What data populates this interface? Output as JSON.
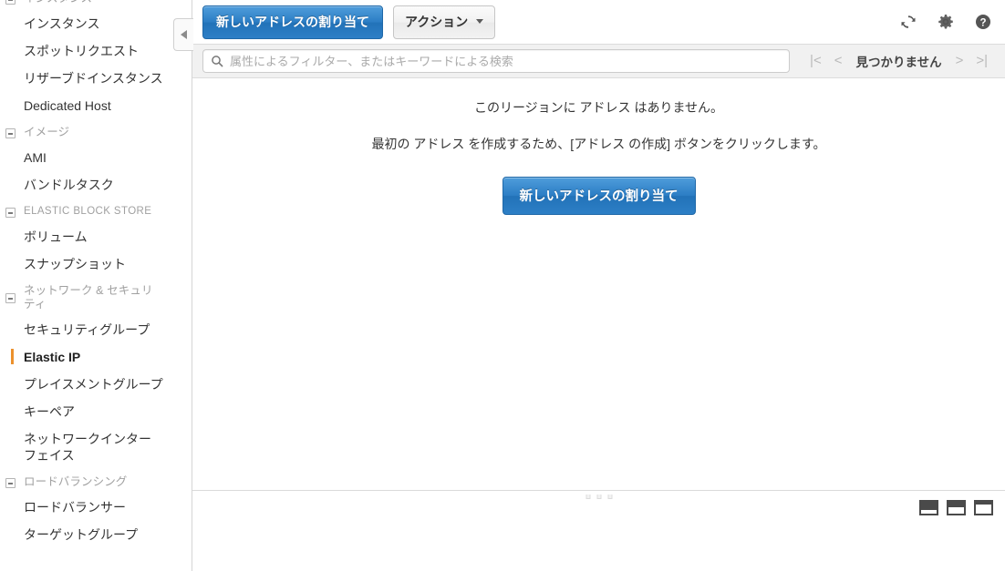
{
  "sidebar": {
    "groups": [
      {
        "id": "instances",
        "label": "インスタンス",
        "caps": false,
        "clipped": true,
        "items": [
          {
            "label": "インスタンス",
            "selected": false
          },
          {
            "label": "スポットリクエスト",
            "selected": false
          },
          {
            "label": "リザーブドインスタンス",
            "selected": false
          },
          {
            "label": "Dedicated Host",
            "selected": false
          }
        ]
      },
      {
        "id": "images",
        "label": "イメージ",
        "caps": false,
        "items": [
          {
            "label": "AMI",
            "selected": false
          },
          {
            "label": "バンドルタスク",
            "selected": false
          }
        ]
      },
      {
        "id": "elastic-block-store",
        "label": "ELASTIC BLOCK STORE",
        "caps": true,
        "items": [
          {
            "label": "ボリューム",
            "selected": false
          },
          {
            "label": "スナップショット",
            "selected": false
          }
        ]
      },
      {
        "id": "network-security",
        "label": "ネットワーク & セキュリティ",
        "caps": false,
        "items": [
          {
            "label": "セキュリティグループ",
            "selected": false
          },
          {
            "label": "Elastic IP",
            "selected": true
          },
          {
            "label": "プレイスメントグループ",
            "selected": false
          },
          {
            "label": "キーペア",
            "selected": false
          },
          {
            "label": "ネットワークインターフェイス",
            "selected": false
          }
        ]
      },
      {
        "id": "load-balancing",
        "label": "ロードバランシング",
        "caps": false,
        "items": [
          {
            "label": "ロードバランサー",
            "selected": false
          },
          {
            "label": "ターゲットグループ",
            "selected": false
          }
        ]
      }
    ],
    "collapse_tab_icon": "chevron-left-icon",
    "selected_accent_color": "#ec912d"
  },
  "toolbar": {
    "allocate_label": "新しいアドレスの割り当て",
    "actions_label": "アクション",
    "icons": [
      {
        "name": "refresh-icon"
      },
      {
        "name": "gear-icon"
      },
      {
        "name": "help-icon"
      }
    ]
  },
  "filterbar": {
    "search_placeholder": "属性によるフィルター、またはキーワードによる検索",
    "search_value": "",
    "search_icon": "search-icon",
    "pager": {
      "first_label": "|<",
      "prev_label": "<",
      "status": "見つかりません",
      "next_label": ">",
      "last_label": ">|"
    }
  },
  "empty_state": {
    "line1": "このリージョンに アドレス はありません。",
    "line2": "最初の アドレス を作成するため、[アドレス の作成] ボタンをクリックします。",
    "cta_label": "新しいアドレスの割り当て"
  },
  "footer": {
    "grip_icon": "resize-grip-icon",
    "panel_toggles": [
      {
        "name": "panel-layout-small-icon"
      },
      {
        "name": "panel-layout-medium-icon"
      },
      {
        "name": "panel-layout-large-icon"
      }
    ]
  },
  "colors": {
    "primary_button": "#2b7dc4",
    "accent": "#ec912d",
    "toolbar_band": "#f1f1f1"
  }
}
